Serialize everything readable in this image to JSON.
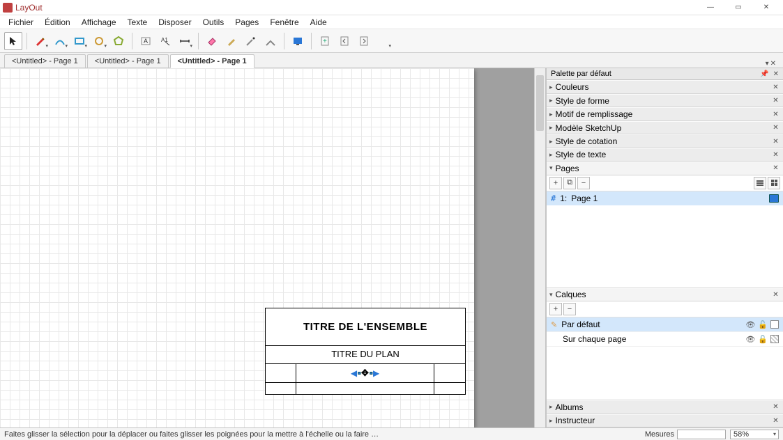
{
  "app": {
    "title": "LayOut"
  },
  "menus": [
    "Fichier",
    "Édition",
    "Affichage",
    "Texte",
    "Disposer",
    "Outils",
    "Pages",
    "Fenêtre",
    "Aide"
  ],
  "tabs": [
    {
      "label": "<Untitled> - Page 1",
      "active": false
    },
    {
      "label": "<Untitled> - Page 1",
      "active": false
    },
    {
      "label": "<Untitled> - Page 1",
      "active": true
    }
  ],
  "titleblock": {
    "main": "TITRE DE L'ENSEMBLE",
    "sub": "TITRE DU PLAN"
  },
  "side": {
    "palette_title": "Palette par défaut",
    "sections": {
      "couleurs": "Couleurs",
      "style_forme": "Style de forme",
      "motif": "Motif de remplissage",
      "modele": "Modèle SketchUp",
      "cotation": "Style de cotation",
      "texte": "Style de texte",
      "pages": "Pages",
      "calques": "Calques",
      "albums": "Albums",
      "instructeur": "Instructeur"
    },
    "pages": {
      "item_num": "1:",
      "item_name": "Page 1"
    },
    "calques": {
      "default": "Par défaut",
      "each_page": "Sur chaque page"
    }
  },
  "status": {
    "hint": "Faites glisser la sélection pour la déplacer ou faites glisser les poignées pour la mettre à l'échelle ou la faire …",
    "measures_label": "Mesures",
    "zoom": "58%"
  }
}
